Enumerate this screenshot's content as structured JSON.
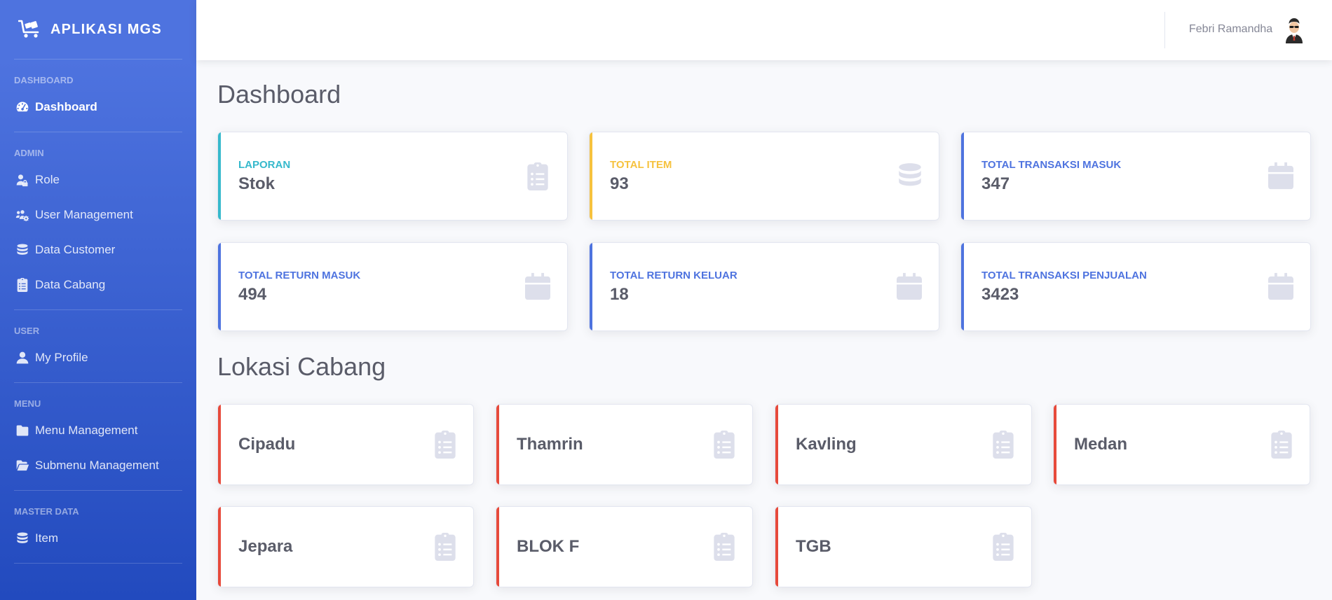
{
  "app": {
    "brand": "APLIKASI MGS",
    "brand_icon": "cart-flatbed-icon"
  },
  "sidebar": {
    "sections": [
      {
        "heading": "DASHBOARD",
        "items": [
          {
            "label": "Dashboard",
            "icon": "tachometer-icon",
            "active": true
          }
        ]
      },
      {
        "heading": "ADMIN",
        "items": [
          {
            "label": "Role",
            "icon": "user-lock-icon"
          },
          {
            "label": "User Management",
            "icon": "users-cog-icon"
          },
          {
            "label": "Data Customer",
            "icon": "database-icon"
          },
          {
            "label": "Data Cabang",
            "icon": "clipboard-list-icon"
          }
        ]
      },
      {
        "heading": "USER",
        "items": [
          {
            "label": "My Profile",
            "icon": "user-icon"
          }
        ]
      },
      {
        "heading": "MENU",
        "items": [
          {
            "label": "Menu Management",
            "icon": "folder-icon"
          },
          {
            "label": "Submenu Management",
            "icon": "folder-open-icon"
          }
        ]
      },
      {
        "heading": "MASTER DATA",
        "items": [
          {
            "label": "Item",
            "icon": "database-icon"
          }
        ]
      }
    ]
  },
  "topbar": {
    "user_name": "Febri Ramandha",
    "avatar": "user-avatar-icon"
  },
  "main": {
    "title": "Dashboard",
    "stats": [
      {
        "label": "LAPORAN",
        "value": "Stok",
        "color": "#36b9cc",
        "icon": "clipboard-list-icon"
      },
      {
        "label": "TOTAL ITEM",
        "value": "93",
        "color": "#f6c23e",
        "icon": "database-icon"
      },
      {
        "label": "TOTAL TRANSAKSI MASUK",
        "value": "347",
        "color": "#4e73df",
        "icon": "calendar-icon"
      },
      {
        "label": "TOTAL RETURN MASUK",
        "value": "494",
        "color": "#4e73df",
        "icon": "calendar-icon"
      },
      {
        "label": "TOTAL RETURN KELUAR",
        "value": "18",
        "color": "#4e73df",
        "icon": "calendar-icon"
      },
      {
        "label": "TOTAL TRANSAKSI PENJUALAN",
        "value": "3423",
        "color": "#4e73df",
        "icon": "calendar-icon"
      }
    ],
    "branches_title": "Lokasi Cabang",
    "branches": [
      {
        "name": "Cipadu"
      },
      {
        "name": "Thamrin"
      },
      {
        "name": "Kavling"
      },
      {
        "name": "Medan"
      },
      {
        "name": "Jepara"
      },
      {
        "name": "BLOK F"
      },
      {
        "name": "TGB"
      }
    ],
    "branch_color": "#e74a3b"
  }
}
